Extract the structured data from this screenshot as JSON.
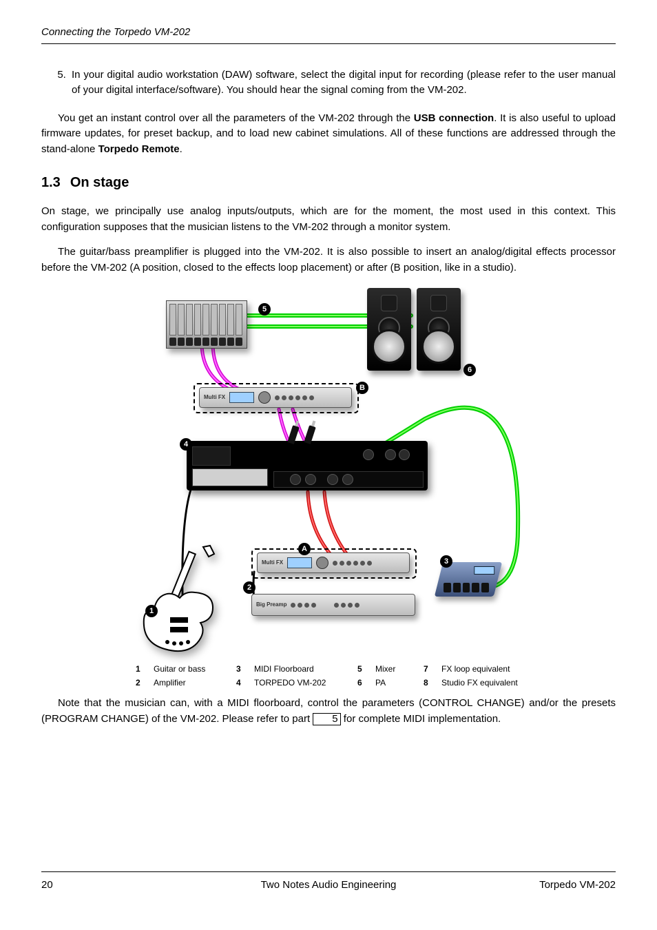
{
  "header": {
    "running": "Connecting the Torpedo VM-202"
  },
  "step5": {
    "num": "5.",
    "text": "In your digital audio workstation (DAW) software, select the digital input for recording (please refer to the user manual of your digital interface/software). You should hear the signal coming from the VM-202."
  },
  "para_usb": {
    "pre": "You get an instant control over all the parameters of the VM-202 through the ",
    "bold1": "USB connection",
    "mid": ". It is also useful to upload firmware updates, for preset backup, and to load new cabinet simulations. All of these functions are addressed through the stand-alone ",
    "bold2": "Torpedo Remote",
    "post": "."
  },
  "section": {
    "num": "1.3",
    "title": "On stage"
  },
  "para_stage1": "On stage, we principally use analog inputs/outputs, which are for the moment, the most used in this context. This configuration supposes that the musician listens to the VM-202 through a monitor system.",
  "para_stage2": "The guitar/bass preamplifier is plugged into the VM-202. It is also possible to insert an analog/digital effects processor before the VM-202 (A position, closed to the effects loop placement) or after (B position, like in a studio).",
  "diagram": {
    "multiFxLabel": "Multi FX",
    "preampLabel": "Big Preamp",
    "markers": {
      "m1": "1",
      "m2": "2",
      "m3": "3",
      "m4": "4",
      "m5": "5",
      "m6": "6",
      "mA": "A",
      "mB": "B"
    }
  },
  "legend": {
    "rows": [
      {
        "k1": "1",
        "v1": "Guitar or bass",
        "k2": "3",
        "v2": "MIDI Floorboard",
        "k3": "5",
        "v3": "Mixer",
        "k4": "7",
        "v4": "FX loop equivalent"
      },
      {
        "k1": "2",
        "v1": "Amplifier",
        "k2": "4",
        "v2": "TORPEDO VM-202",
        "k3": "6",
        "v3": "PA",
        "k4": "8",
        "v4": "Studio FX equivalent"
      }
    ]
  },
  "note": {
    "pre": "Note that the musician can, with a MIDI floorboard, control the parameters (CONTROL CHANGE) and/or the presets (PROGRAM CHANGE) of the VM-202. Please refer to part ",
    "ref": "5",
    "post": " for complete MIDI implementation."
  },
  "footer": {
    "page": "20",
    "center": "Two Notes Audio Engineering",
    "right": "Torpedo VM-202"
  }
}
